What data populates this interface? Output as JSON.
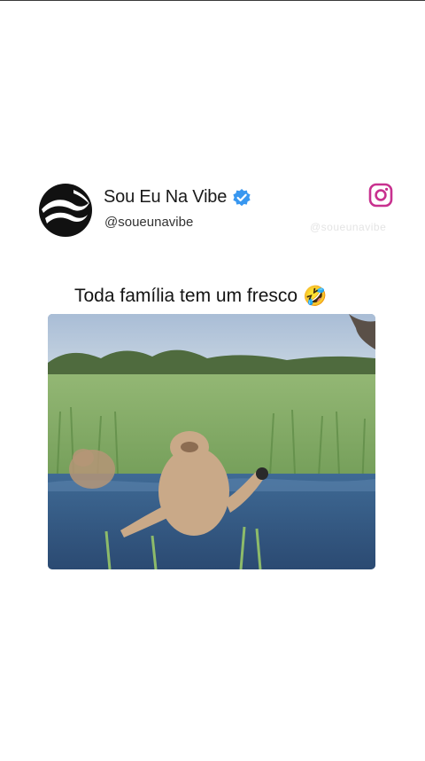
{
  "post": {
    "account_name": "Sou Eu Na Vibe",
    "handle": "@soueunavibe",
    "caption": "Toda família tem um fresco",
    "caption_emoji": "🤣",
    "watermark": "@soueunavibe"
  },
  "icons": {
    "avatar": "wave-logo-avatar",
    "verified": "verified-badge-icon",
    "platform": "instagram-icon"
  },
  "colors": {
    "verified_blue": "#3897f0",
    "instagram_magenta": "#c8318f",
    "text_primary": "#1a1a1a"
  }
}
